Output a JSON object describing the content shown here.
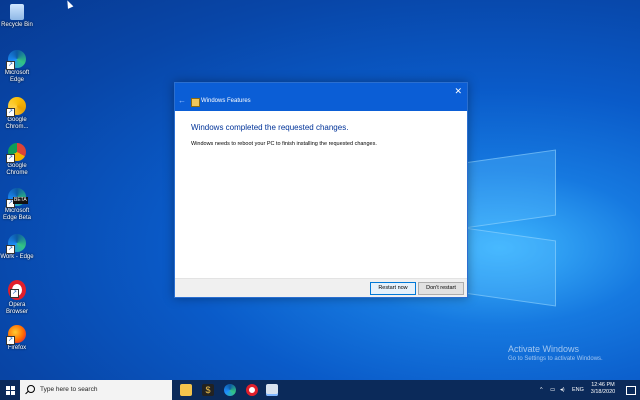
{
  "desktop": {
    "icons": [
      {
        "label": "Recycle Bin",
        "icon": "recycle-bin-icon"
      },
      {
        "label": "Microsoft Edge",
        "icon": "edge-icon"
      },
      {
        "label": "Google Chrom...",
        "icon": "chrome-canary-icon"
      },
      {
        "label": "Google Chrome",
        "icon": "chrome-icon"
      },
      {
        "label": "Microsoft Edge Beta",
        "icon": "edge-beta-icon",
        "badge": "BETA"
      },
      {
        "label": "Work - Edge",
        "icon": "edge-work-icon"
      },
      {
        "label": "Opera Browser",
        "icon": "opera-icon"
      },
      {
        "label": "Firefox",
        "icon": "firefox-icon"
      }
    ]
  },
  "dialog": {
    "title": "Windows Features",
    "heading": "Windows completed the requested changes.",
    "message": "Windows needs to reboot your PC to finish installing the requested changes.",
    "restart_button": "Restart now",
    "dont_restart_button": "Don't restart",
    "close_glyph": "✕",
    "back_glyph": "←"
  },
  "watermark": {
    "line1": "Activate Windows",
    "line2": "Go to Settings to activate Windows."
  },
  "taskbar": {
    "search_placeholder": "Type here to search",
    "language": "ENG",
    "time": "12:46 PM",
    "date": "3/18/2020"
  },
  "colors": {
    "accent": "#0b5ed6",
    "taskbar": "#0b2a5a",
    "heading": "#003399"
  }
}
